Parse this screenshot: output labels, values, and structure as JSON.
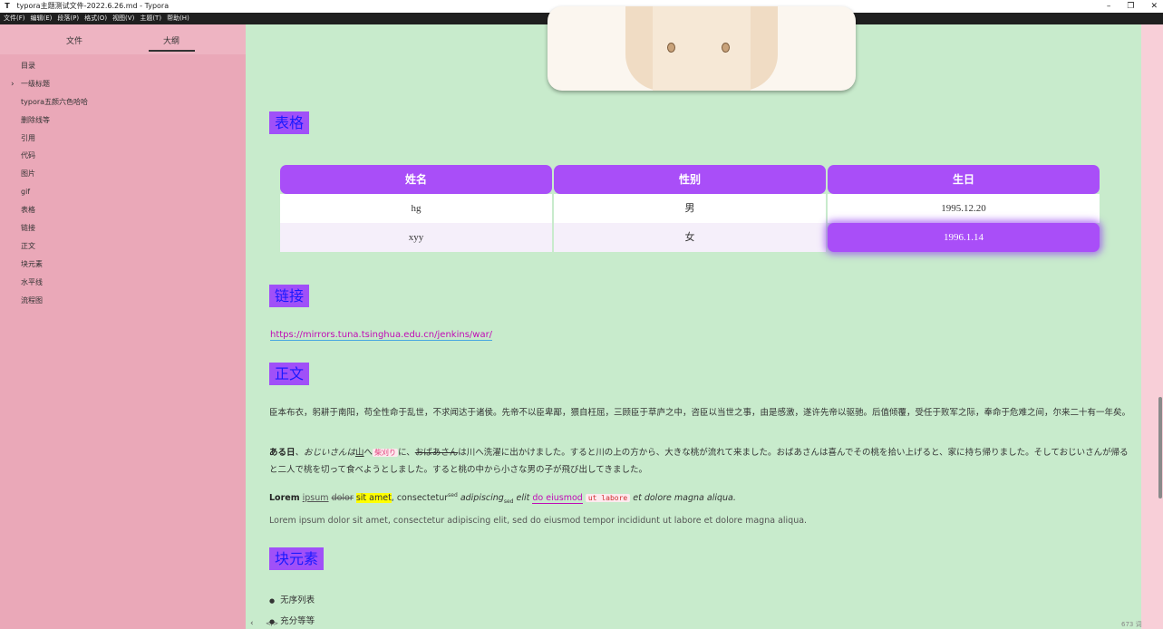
{
  "window": {
    "app_icon": "T",
    "title": "typora主题测试文件-2022.6.26.md - Typora",
    "minimize": "–",
    "restore": "❐",
    "close": "✕"
  },
  "menu": [
    "文件(F)",
    "编辑(E)",
    "段落(P)",
    "格式(O)",
    "视图(V)",
    "主题(T)",
    "帮助(H)"
  ],
  "sidebar": {
    "tab_files": "文件",
    "tab_outline": "大纲",
    "items": [
      "目录",
      "一级标题",
      "typora五颜六色哈哈",
      "删除线等",
      "引用",
      "代码",
      "图片",
      "gif",
      "表格",
      "链接",
      "正文",
      "块元素",
      "水平线",
      "流程图"
    ],
    "collapse_glyph": "‹",
    "chevron_glyph": "›",
    "source_glyph": "</>"
  },
  "status": {
    "word_count": "673 词"
  },
  "content": {
    "h_table": "表格",
    "table": {
      "headers": [
        "姓名",
        "性别",
        "生日"
      ],
      "rows": [
        [
          "hg",
          "男",
          "1995.12.20"
        ],
        [
          "xyy",
          "女",
          "1996.1.14"
        ]
      ]
    },
    "h_link": "链接",
    "link_url": "https://mirrors.tuna.tsinghua.edu.cn/jenkins/war/",
    "h_body": "正文",
    "p1": "臣本布衣，躬耕于南阳，苟全性命于乱世，不求闻达于诸侯。先帝不以臣卑鄙，猥自枉屈，三顾臣于草庐之中，咨臣以当世之事，由是感激，遂许先帝以驱驰。后值倾覆，受任于败军之际，奉命于危难之间，尔来二十有一年矣。",
    "p2": {
      "bold": "ある日",
      "t1": "、おじいさんは",
      "u1": "山",
      "t2": "へ",
      "tag": "柴刈り",
      "t3": "に、",
      "strike": "おばあさん",
      "t4": "は川へ洗濯に出かけました。すると川の上の方から、大きな桃が流れて来ました。おばあさんは喜んでその桃を拾い上げると、家に持ち帰りました。そしておじいさんが帰ると二人で桃を切って食べようとしました。すると桃の中から小さな男の子が飛び出してきました。"
    },
    "p3": {
      "bold": "Lorem",
      "u1": "ipsum",
      "strike": "dolor",
      "yellow": "sit amet",
      "t1": ", consectetur",
      "sup": "sed",
      "t2": "adipiscing",
      "sub": "sed",
      "t3": "elit",
      "link": "do eiusmod",
      "code": "ut labore",
      "t4": "et dolore magna aliqua."
    },
    "p4": "Lorem ipsum dolor sit amet, consectetur adipiscing elit, sed do eiusmod tempor incididunt ut labore et dolore magna aliqua.",
    "h_block": "块元素",
    "bullets": [
      "无序列表",
      "充分等等"
    ]
  },
  "colors": {
    "background": "#c8ebcc",
    "heading_bg": "#a050f8",
    "heading_text": "#1a1aff",
    "table_head": "#a94ef8",
    "sidebar": "#eaa8b8"
  }
}
